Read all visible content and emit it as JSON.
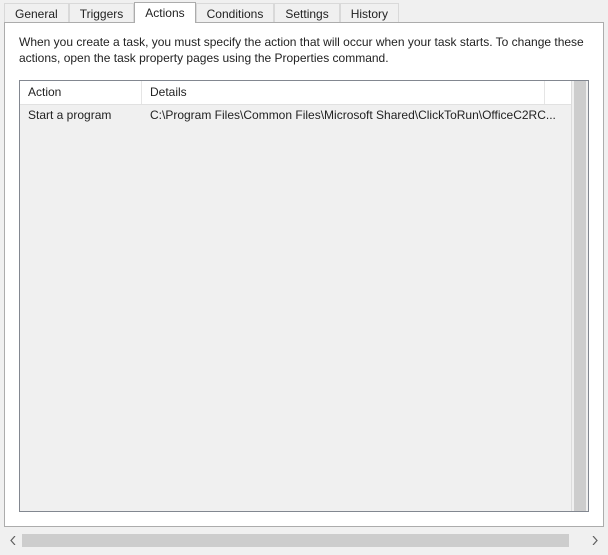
{
  "tabs": {
    "general": "General",
    "triggers": "Triggers",
    "actions": "Actions",
    "conditions": "Conditions",
    "settings": "Settings",
    "history": "History"
  },
  "active_tab": "actions",
  "panel": {
    "description": "When you create a task, you must specify the action that will occur when your task starts.  To change these actions, open the task property pages using the Properties command."
  },
  "list": {
    "headers": {
      "action": "Action",
      "details": "Details"
    },
    "rows": [
      {
        "action": "Start a program",
        "details": "C:\\Program Files\\Common Files\\Microsoft Shared\\ClickToRun\\OfficeC2RC..."
      }
    ]
  }
}
